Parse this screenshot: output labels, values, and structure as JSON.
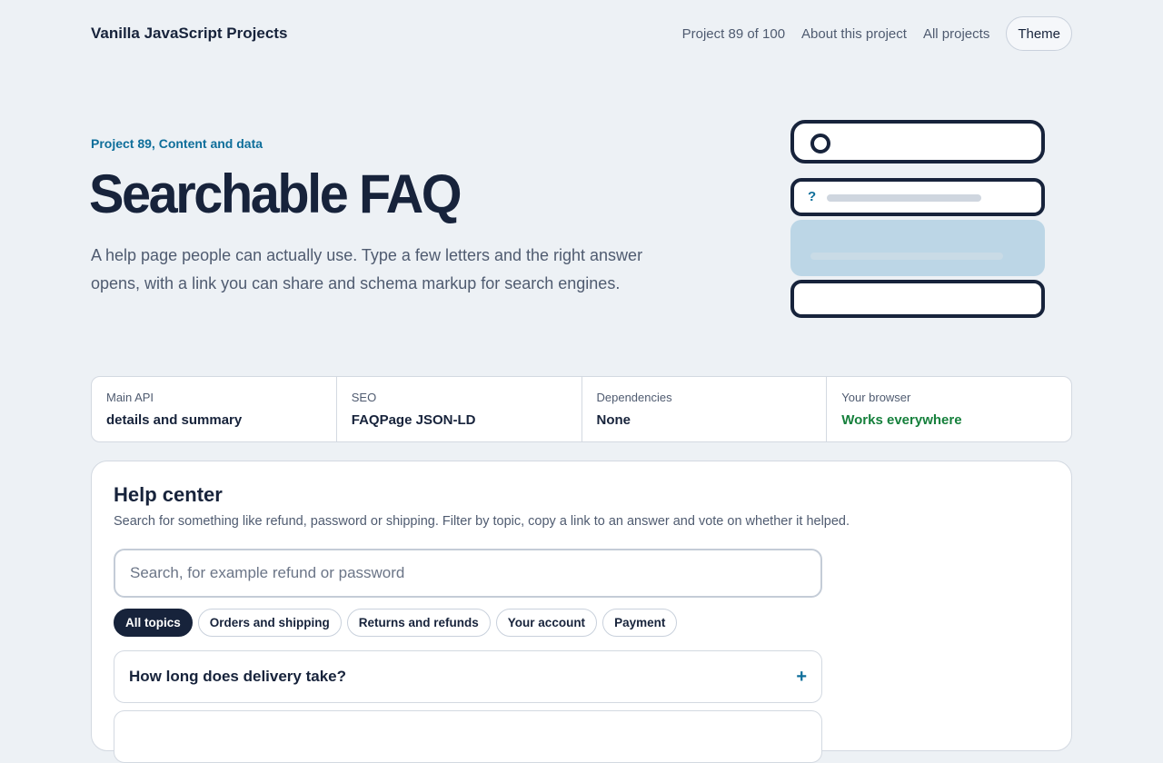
{
  "header": {
    "brand": "Vanilla JavaScript Projects",
    "nav": {
      "progress": "Project 89 of 100",
      "about": "About this project",
      "all": "All projects"
    },
    "theme_label": "Theme"
  },
  "hero": {
    "eyebrow": "Project 89, Content and data",
    "title": "Searchable FAQ",
    "description": "A help page people can actually use. Type a few letters and the right answer opens, with a link you can share and schema markup for search engines.",
    "illustration": {
      "question_mark": "?"
    }
  },
  "info": [
    {
      "label": "Main API",
      "value": "details and summary"
    },
    {
      "label": "SEO",
      "value": "FAQPage JSON-LD"
    },
    {
      "label": "Dependencies",
      "value": "None"
    },
    {
      "label": "Your browser",
      "value": "Works everywhere"
    }
  ],
  "help": {
    "title": "Help center",
    "description": "Search for something like refund, password or shipping. Filter by topic, copy a link to an answer and vote on whether it helped.",
    "search_placeholder": "Search, for example refund or password",
    "search_value": "",
    "topics": [
      "All topics",
      "Orders and shipping",
      "Returns and refunds",
      "Your account",
      "Payment"
    ],
    "active_topic": "All topics",
    "faqs": [
      {
        "question": "How long does delivery take?",
        "toggle": "+"
      },
      {
        "question": "",
        "toggle": ""
      }
    ]
  },
  "colors": {
    "background": "#edf1f5",
    "ink": "#17233b",
    "accent": "#0e6e9a",
    "success": "#16803c"
  },
  "icons": {
    "search_illustration": "magnifier-circle-icon",
    "question": "question-mark-icon",
    "expand": "plus-icon"
  }
}
